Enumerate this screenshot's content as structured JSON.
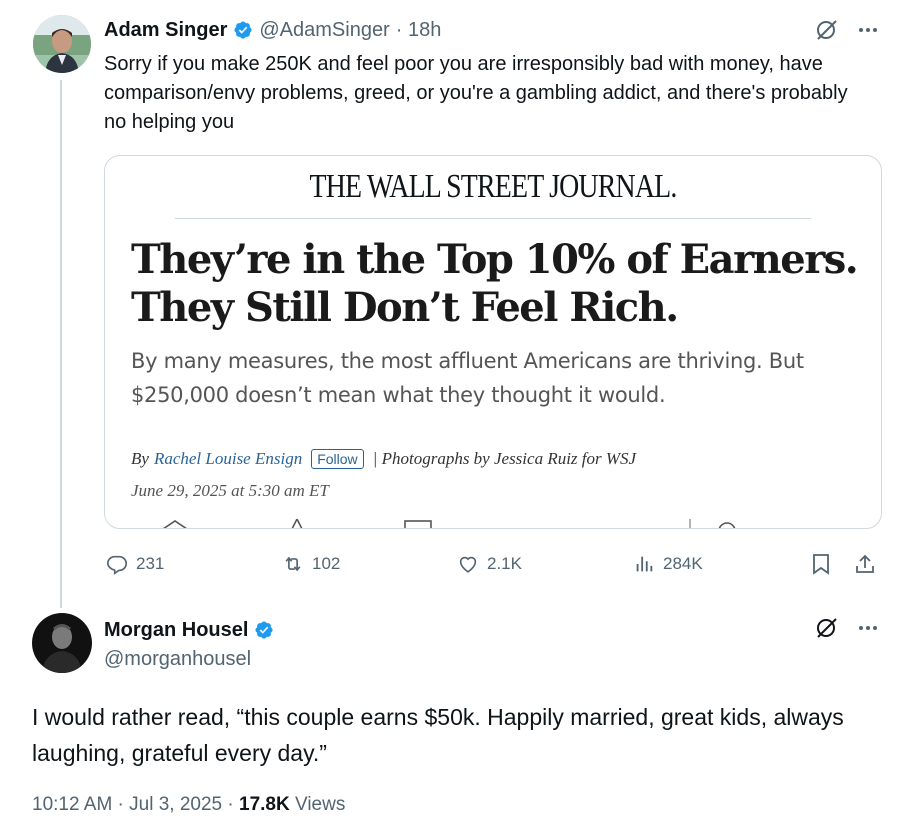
{
  "tweet1": {
    "name": "Adam Singer",
    "handle": "@AdamSinger",
    "time": "· 18h",
    "text": "Sorry if you make 250K and feel poor you are irresponsibly bad with money, have comparison/envy problems, greed, or you're a gambling addict, and there's probably no helping you",
    "card": {
      "masthead": "THE WALL STREET JOURNAL.",
      "headline": "They’re in the Top 10% of Earners. They Still Don’t Feel Rich.",
      "dek": "By many measures, the most affluent Americans are thriving. But $250,000 doesn’t mean what they thought it would.",
      "by": "By",
      "author": "Rachel Louise Ensign",
      "follow": "Follow",
      "photo_credit": "| Photographs by Jessica Ruiz for WSJ",
      "date": "June 29, 2025 at 5:30 am ET"
    },
    "actions": {
      "replies": "231",
      "reposts": "102",
      "likes": "2.1K",
      "views": "284K"
    }
  },
  "tweet2": {
    "name": "Morgan Housel",
    "handle": "@morganhousel",
    "text": "I would rather read, “this couple earns $50k. Happily married, great kids, always laughing, grateful every day.”",
    "time": "10:12 AM · Jul 3, 2025 · ",
    "views_count": "17.8K",
    "views_label": " Views"
  },
  "colors": {
    "verified": "#1d9bf0",
    "text": "#0f1419",
    "secondary": "#536471",
    "border": "#cfd9de",
    "wsj_link": "#2a6496"
  }
}
